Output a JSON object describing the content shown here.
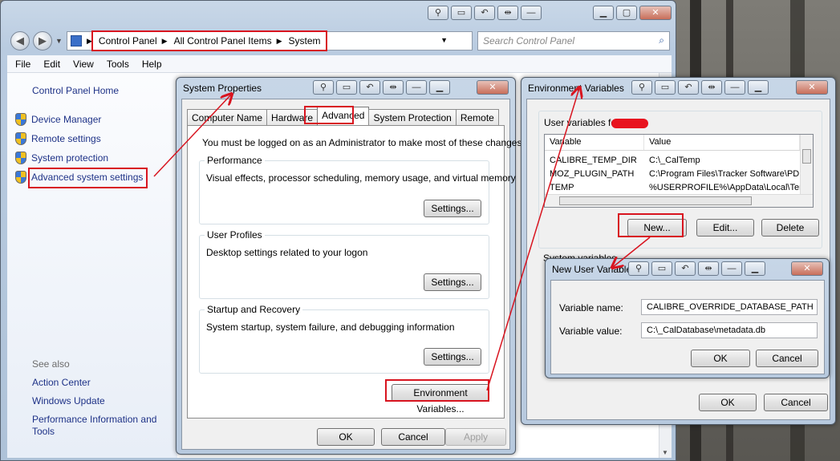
{
  "control_panel": {
    "breadcrumb": [
      "Control Panel",
      "All Control Panel Items",
      "System"
    ],
    "search_placeholder": "Search Control Panel",
    "menu": [
      "File",
      "Edit",
      "View",
      "Tools",
      "Help"
    ],
    "home_link": "Control Panel Home",
    "tasks": [
      "Device Manager",
      "Remote settings",
      "System protection",
      "Advanced system settings"
    ],
    "see_also_title": "See also",
    "see_also": [
      "Action Center",
      "Windows Update",
      "Performance Information and Tools"
    ]
  },
  "system_properties": {
    "title": "System Properties",
    "tabs": [
      "Computer Name",
      "Hardware",
      "Advanced",
      "System Protection",
      "Remote"
    ],
    "active_tab": "Advanced",
    "admin_note": "You must be logged on as an Administrator to make most of these changes.",
    "performance": {
      "title": "Performance",
      "desc": "Visual effects, processor scheduling, memory usage, and virtual memory",
      "button": "Settings..."
    },
    "user_profiles": {
      "title": "User Profiles",
      "desc": "Desktop settings related to your logon",
      "button": "Settings..."
    },
    "startup_recovery": {
      "title": "Startup and Recovery",
      "desc": "System startup, system failure, and debugging information",
      "button": "Settings..."
    },
    "env_button": "Environment Variables...",
    "ok": "OK",
    "cancel": "Cancel",
    "apply": "Apply"
  },
  "environment_variables": {
    "title": "Environment Variables",
    "user_vars_label": "User variables for",
    "columns": [
      "Variable",
      "Value"
    ],
    "rows": [
      {
        "variable": "CALIBRE_TEMP_DIR",
        "value": "C:\\_CalTemp"
      },
      {
        "variable": "MOZ_PLUGIN_PATH",
        "value": "C:\\Program Files\\Tracker Software\\PDF"
      },
      {
        "variable": "TEMP",
        "value": "%USERPROFILE%\\AppData\\Local\\Temp"
      }
    ],
    "new_button": "New...",
    "edit_button": "Edit...",
    "delete_button": "Delete",
    "system_vars_label": "System variables",
    "ok": "OK",
    "cancel": "Cancel"
  },
  "new_user_variable": {
    "title": "New User Variable",
    "name_label": "Variable name:",
    "name_value": "CALIBRE_OVERRIDE_DATABASE_PATH",
    "value_label": "Variable value:",
    "value_value": "C:\\_CalDatabase\\metadata.db",
    "ok": "OK",
    "cancel": "Cancel"
  },
  "colors": {
    "annotation": "#d8141f",
    "link": "#1e3287"
  }
}
